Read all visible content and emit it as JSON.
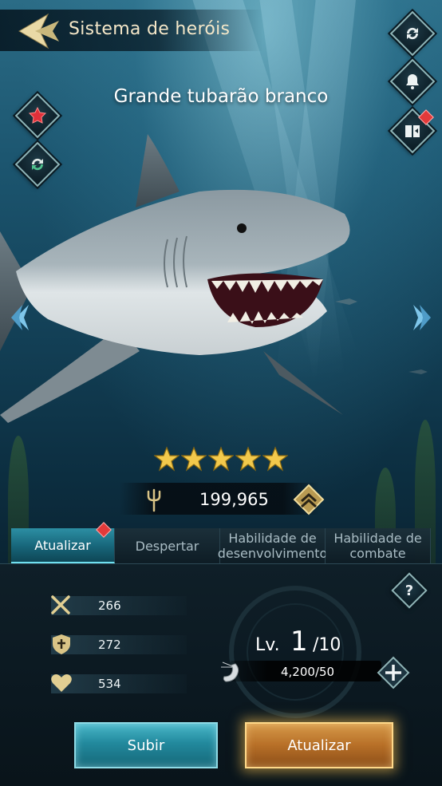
{
  "header": {
    "title": "Sistema de heróis",
    "back_icon": "back-arrow-icon"
  },
  "hero": {
    "name": "Grande tubarão branco",
    "stars": 5,
    "power": "199,965"
  },
  "left_buttons": [
    {
      "icon": "red-gem-icon"
    },
    {
      "icon": "cycle-icon"
    }
  ],
  "right_buttons": [
    {
      "icon": "refresh-icon"
    },
    {
      "icon": "bell-icon"
    },
    {
      "icon": "book-icon",
      "badge": true
    }
  ],
  "tabs": [
    {
      "label": "Atualizar",
      "active": true,
      "badge": true
    },
    {
      "label": "Despertar",
      "active": false
    },
    {
      "label": "Habilidade de desenvolvimento",
      "active": false
    },
    {
      "label": "Habilidade de combate",
      "active": false
    }
  ],
  "stats": [
    {
      "icon": "swords-icon",
      "value": "266"
    },
    {
      "icon": "shield-icon",
      "value": "272"
    },
    {
      "icon": "heart-icon",
      "value": "534"
    }
  ],
  "level": {
    "prefix": "Lv.",
    "current": "1",
    "max": "/10"
  },
  "exp": {
    "text": "4,200/50",
    "icon": "shrimp-icon"
  },
  "buttons": {
    "climb": "Subir",
    "upgrade": "Atualizar"
  },
  "colors": {
    "accent_teal": "#2c8fa4",
    "accent_gold": "#c98b3d",
    "badge_red": "#e23a3a",
    "title_cream": "#f4e7c8"
  }
}
